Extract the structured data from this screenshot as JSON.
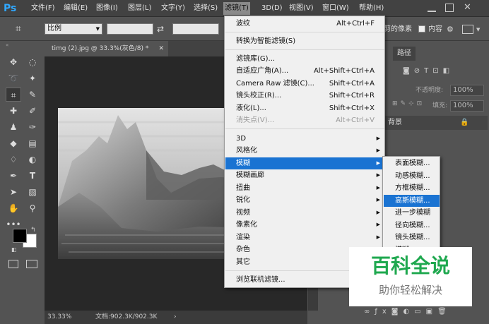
{
  "app": {
    "logo": "Ps"
  },
  "menubar": [
    "文件(F)",
    "编辑(E)",
    "图像(I)",
    "图层(L)",
    "文字(Y)",
    "选择(S)",
    "滤镜(T)",
    "3D(D)",
    "视图(V)",
    "窗口(W)",
    "帮助(H)"
  ],
  "options": {
    "ratio": "比例",
    "delete_pixels": "删除裁剪的像素",
    "content_aware": "内容"
  },
  "document": {
    "tab_title": "timg (2).jpg @ 33.3%(灰色/8) *",
    "zoom": "33.33%",
    "doc_info": "文档:902.3K/902.3K"
  },
  "panels": {
    "tab_paths": "路径",
    "opacity_label": "不透明度:",
    "opacity_value": "100%",
    "fill_label": "填充:",
    "fill_value": "100%",
    "layer_name": "背景"
  },
  "filter_menu": {
    "last_filter": {
      "label": "波纹",
      "shortcut": "Alt+Ctrl+F"
    },
    "convert_smart": "转换为智能滤镜(S)",
    "gallery": "滤镜库(G)...",
    "adaptive_wide": {
      "label": "自适应广角(A)...",
      "shortcut": "Alt+Shift+Ctrl+A"
    },
    "camera_raw": {
      "label": "Camera Raw 滤镜(C)...",
      "shortcut": "Shift+Ctrl+A"
    },
    "lens_correction": {
      "label": "镜头校正(R)...",
      "shortcut": "Shift+Ctrl+R"
    },
    "liquify": {
      "label": "液化(L)...",
      "shortcut": "Shift+Ctrl+X"
    },
    "vanishing_point": {
      "label": "消失点(V)...",
      "shortcut": "Alt+Ctrl+V"
    },
    "groups": [
      "3D",
      "风格化",
      "模糊",
      "模糊画廊",
      "扭曲",
      "锐化",
      "视频",
      "像素化",
      "渲染",
      "杂色",
      "其它"
    ],
    "browse_online": "浏览联机滤镜..."
  },
  "blur_submenu": [
    "表面模糊...",
    "动感模糊...",
    "方框模糊...",
    "高斯模糊...",
    "进一步模糊",
    "径向模糊...",
    "镜头模糊...",
    "模糊"
  ],
  "watermark": {
    "title": "百科全说",
    "subtitle": "助你轻松解决"
  },
  "colors": {
    "highlight": "#1a73d2",
    "watermark_title": "#1fa84f"
  }
}
